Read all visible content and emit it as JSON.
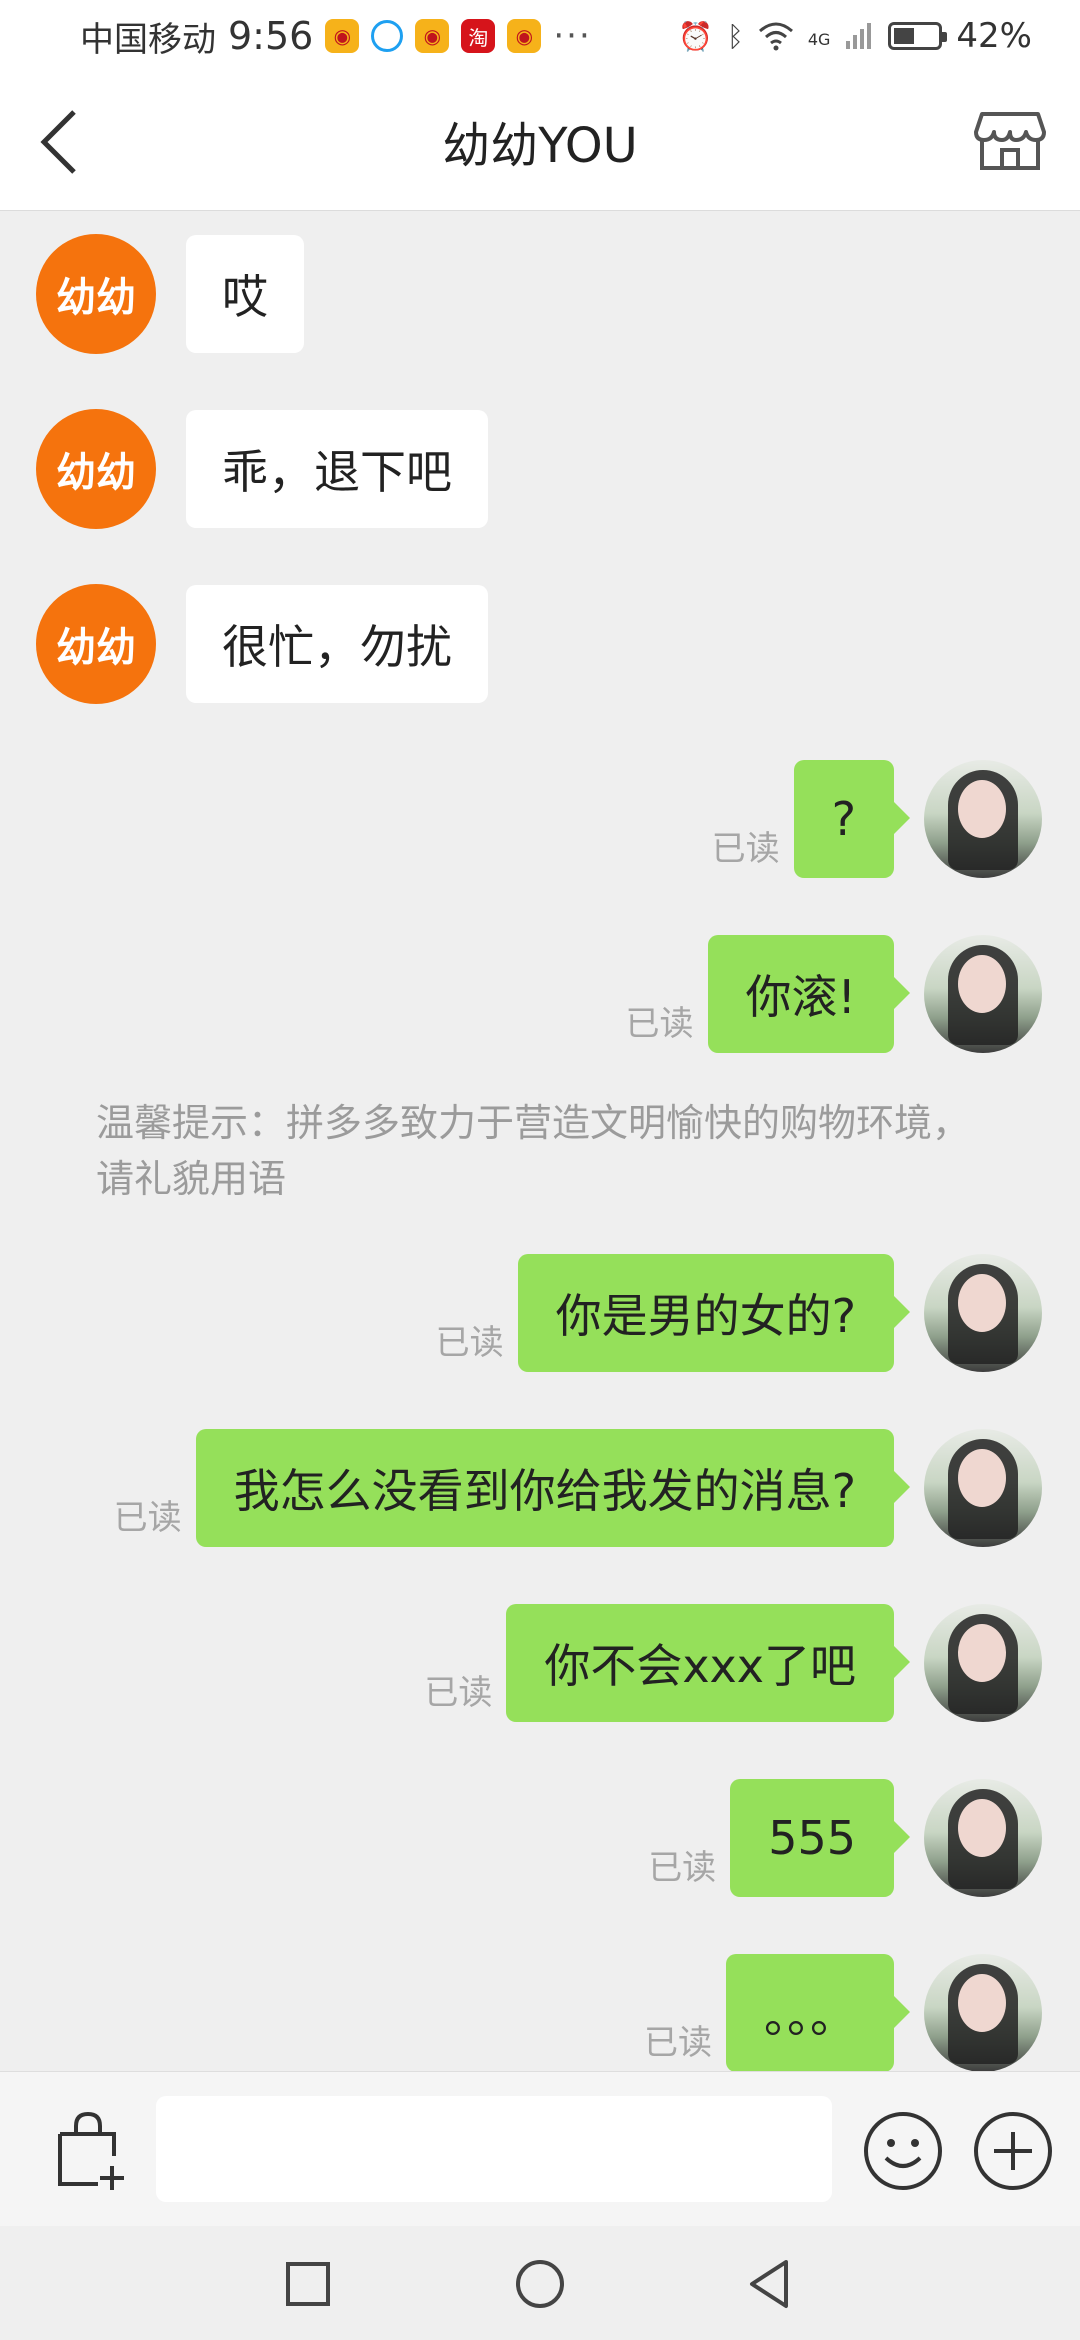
{
  "status_bar": {
    "carrier": "中国移动",
    "time": "9:56",
    "notification_icons": [
      "weibo-icon",
      "qq-browser-icon",
      "weibo-icon",
      "taobao-icon",
      "weibo-icon"
    ],
    "more": "···",
    "network": "4G",
    "battery": "42%"
  },
  "header": {
    "title": "幼幼YOU"
  },
  "chat": {
    "other_avatar_text": "幼幼",
    "incoming": [
      {
        "text": "哎"
      },
      {
        "text": "乖，退下吧"
      },
      {
        "text": "很忙，勿扰"
      }
    ],
    "read_label": "已读",
    "outgoing_a": [
      {
        "text": "?"
      },
      {
        "text": "你滚!"
      }
    ],
    "notice": "温馨提示：拼多多致力于营造文明愉快的购物环境，请礼貌用语",
    "outgoing_b": [
      {
        "text": "你是男的女的?"
      },
      {
        "text": "我怎么没看到你给我发的消息?"
      },
      {
        "text": "你不会xxx了吧"
      },
      {
        "text": "555"
      },
      {
        "text": "。。。"
      }
    ]
  },
  "input_bar": {
    "placeholder": ""
  },
  "colors": {
    "accent_orange": "#f5730d",
    "bubble_green": "#95e05a",
    "background": "#efefef"
  }
}
